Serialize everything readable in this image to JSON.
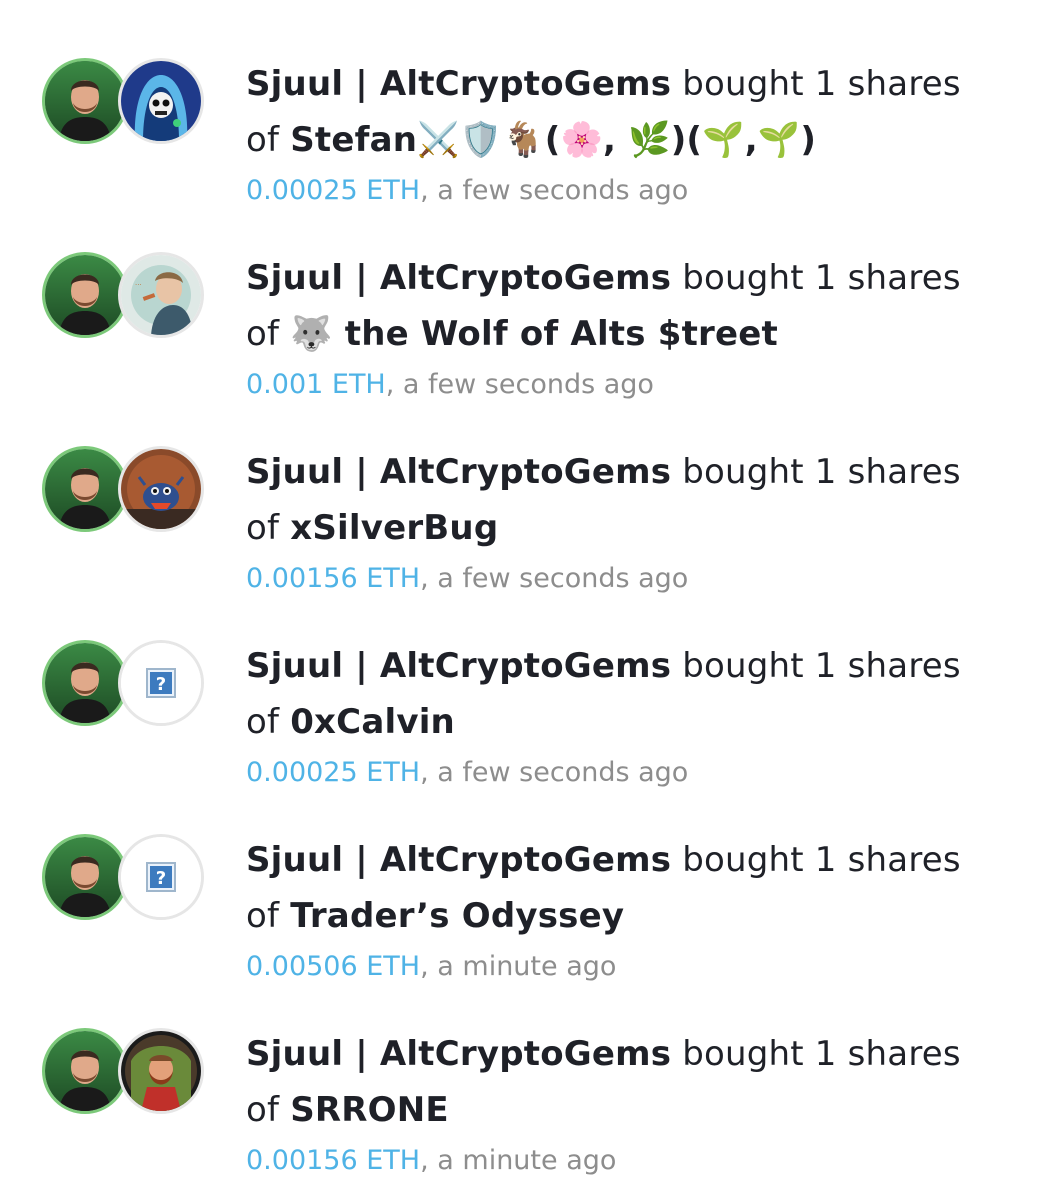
{
  "feed": {
    "items": [
      {
        "trader": "Sjuul | AltCryptoGems",
        "verb": "bought 1 shares",
        "of": "of",
        "subject": "Stefan⚔️🛡️🐐(🌸, 🌿)(🌱,🌱)",
        "price": "0.00025 ETH",
        "time": ", a few seconds ago",
        "subject_avatar_icon": "hooded-skull-avatar"
      },
      {
        "trader": "Sjuul | AltCryptoGems",
        "verb": "bought 1 shares",
        "of": "of",
        "subject": "🐺 the Wolf of Alts $treet",
        "price": "0.001 ETH",
        "time": ", a few seconds ago",
        "subject_avatar_icon": "wolf-of-wall-street-avatar"
      },
      {
        "trader": "Sjuul | AltCryptoGems",
        "verb": "bought 1 shares",
        "of": "of",
        "subject": "xSilverBug",
        "price": "0.00156 ETH",
        "time": ", a few seconds ago",
        "subject_avatar_icon": "silver-bug-avatar"
      },
      {
        "trader": "Sjuul | AltCryptoGems",
        "verb": "bought 1 shares",
        "of": "of",
        "subject": "0xCalvin",
        "price": "0.00025 ETH",
        "time": ", a few seconds ago",
        "subject_avatar_icon": "missing-image-icon"
      },
      {
        "trader": "Sjuul | AltCryptoGems",
        "verb": "bought 1 shares",
        "of": "of",
        "subject": "Trader’s Odyssey",
        "price": "0.00506 ETH",
        "time": ", a minute ago",
        "subject_avatar_icon": "missing-image-icon"
      },
      {
        "trader": "Sjuul | AltCryptoGems",
        "verb": "bought 1 shares",
        "of": "of",
        "subject": "SRRONE",
        "price": "0.00156 ETH",
        "time": ", a minute ago",
        "subject_avatar_icon": "bearded-man-avatar"
      }
    ]
  },
  "colors": {
    "price": "#4fb3e6",
    "time": "#8d8d8d",
    "text": "#1f2128",
    "trader_avatar_ring": "#7cc97a"
  }
}
